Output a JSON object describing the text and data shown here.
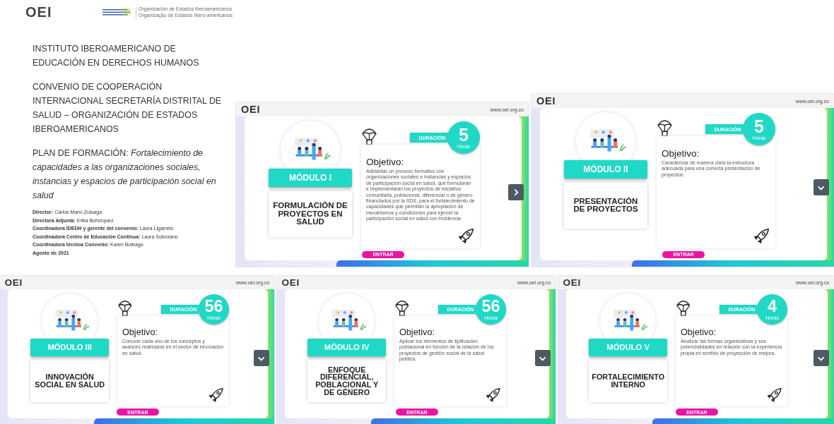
{
  "document": {
    "logo": "OEI",
    "partner_logo_lines": [
      "Organización de Estados Iberoamericanos",
      "Organização de Estados Ibero-americanos"
    ],
    "headings": [
      "INSTITUTO IBEROAMERICANO DE EDUCACIÓN EN DERECHOS HUMANOS",
      "CONVENIO DE COOPERACIÓN INTERNACIONAL SECRETARÍA DISTRITAL DE SALUD – ORGANIZACIÓN DE ESTADOS IBEROAMERICANOS",
      "PLAN DE FORMACIÓN: *Fortalecimiento de capacidades a las organizaciones sociales, instancias y espacios de participación social en salud*"
    ],
    "credits": [
      "**Director:** Carlos Mario Zuluaga",
      "**Directora Adjunta:** Erika Bohorquez",
      "**Coordinadora IDEDH y gerente del convenio:** Laura Ligarreto",
      "**Coordinadora Centro de Educación Continua:** Laura Solorzano",
      "**Coordinadora técnica Convenio:** Karen Buitrago"
    ],
    "date": "Agosto de 2021"
  },
  "modules": [
    {
      "logo": "OEI",
      "url": "www.oei.org.co",
      "module": "MÓDULO I",
      "title": "FORMULACIÓN DE PROYECTOS EN SALUD",
      "duration_label": "DURACIÓN",
      "hours": "5",
      "hours_unit": "Horas",
      "objective_label": "Objetivo:",
      "objective": "Adelantar un proceso formativo con organizaciones sociales e instancias y espacios de participación social en salud, que formularán e implementarán los proyectos de iniciativa comunitaria, poblacional, diferencial o de género financiados por la SDS, para el fortalecimiento de capacidades que permitan la apropiación de mecanismos y condiciones para ejercer la participación social en salud con incidencia",
      "enter": "ENTRAR",
      "nav_points_down": false
    },
    {
      "logo": "OEI",
      "url": "www.oei.org.co",
      "module": "MÓDULO II",
      "title": "PRESENTACIÓN DE PROYECTOS",
      "duration_label": "DURACIÓN",
      "hours": "5",
      "hours_unit": "Horas",
      "objective_label": "Objetivo:",
      "objective": "Caracterizar de manera clara la estructura adecuada para una correcta presentación de proyectos.",
      "enter": "ENTRAR",
      "nav_points_down": true
    },
    {
      "logo": "OEI",
      "url": "www.oei.org.co",
      "module": "MÓDULO III",
      "title": "INNOVACIÓN SOCIAL EN SALUD",
      "duration_label": "DURACIÓN",
      "hours": "56",
      "hours_unit": "Horas",
      "objective_label": "Objetivo:",
      "objective": "Conocer cada uno de los conceptos y avances realizados en el sector de innovación en salud.",
      "enter": "ENTRAR",
      "nav_points_down": true
    },
    {
      "logo": "OEI",
      "url": "www.oei.org.co",
      "module": "MÓDULO IV",
      "title": "ENFOQUE DIFERENCIAL, POBLACIONAL Y DE GÉNERO",
      "duration_label": "DURACIÓN",
      "hours": "56",
      "hours_unit": "Horas",
      "objective_label": "Objetivo:",
      "objective": "Aplicar los elementos de tipificación poblacional en función de la relación de los proyectos de gestión social de la salud pública.",
      "enter": "ENTRAR",
      "nav_points_down": true
    },
    {
      "logo": "OEI",
      "url": "www.oei.org.co",
      "module": "MÓDULO V",
      "title": "FORTALECIMIENTO INTERNO",
      "duration_label": "DURACIÓN",
      "hours": "4",
      "hours_unit": "Horas",
      "objective_label": "Objetivo:",
      "objective": "Analizar las formas organizativas y sus potencialidades en relación con la experiencia propia en sentido de proyección de mejora.",
      "enter": "ENTRAR",
      "nav_points_down": true
    }
  ]
}
